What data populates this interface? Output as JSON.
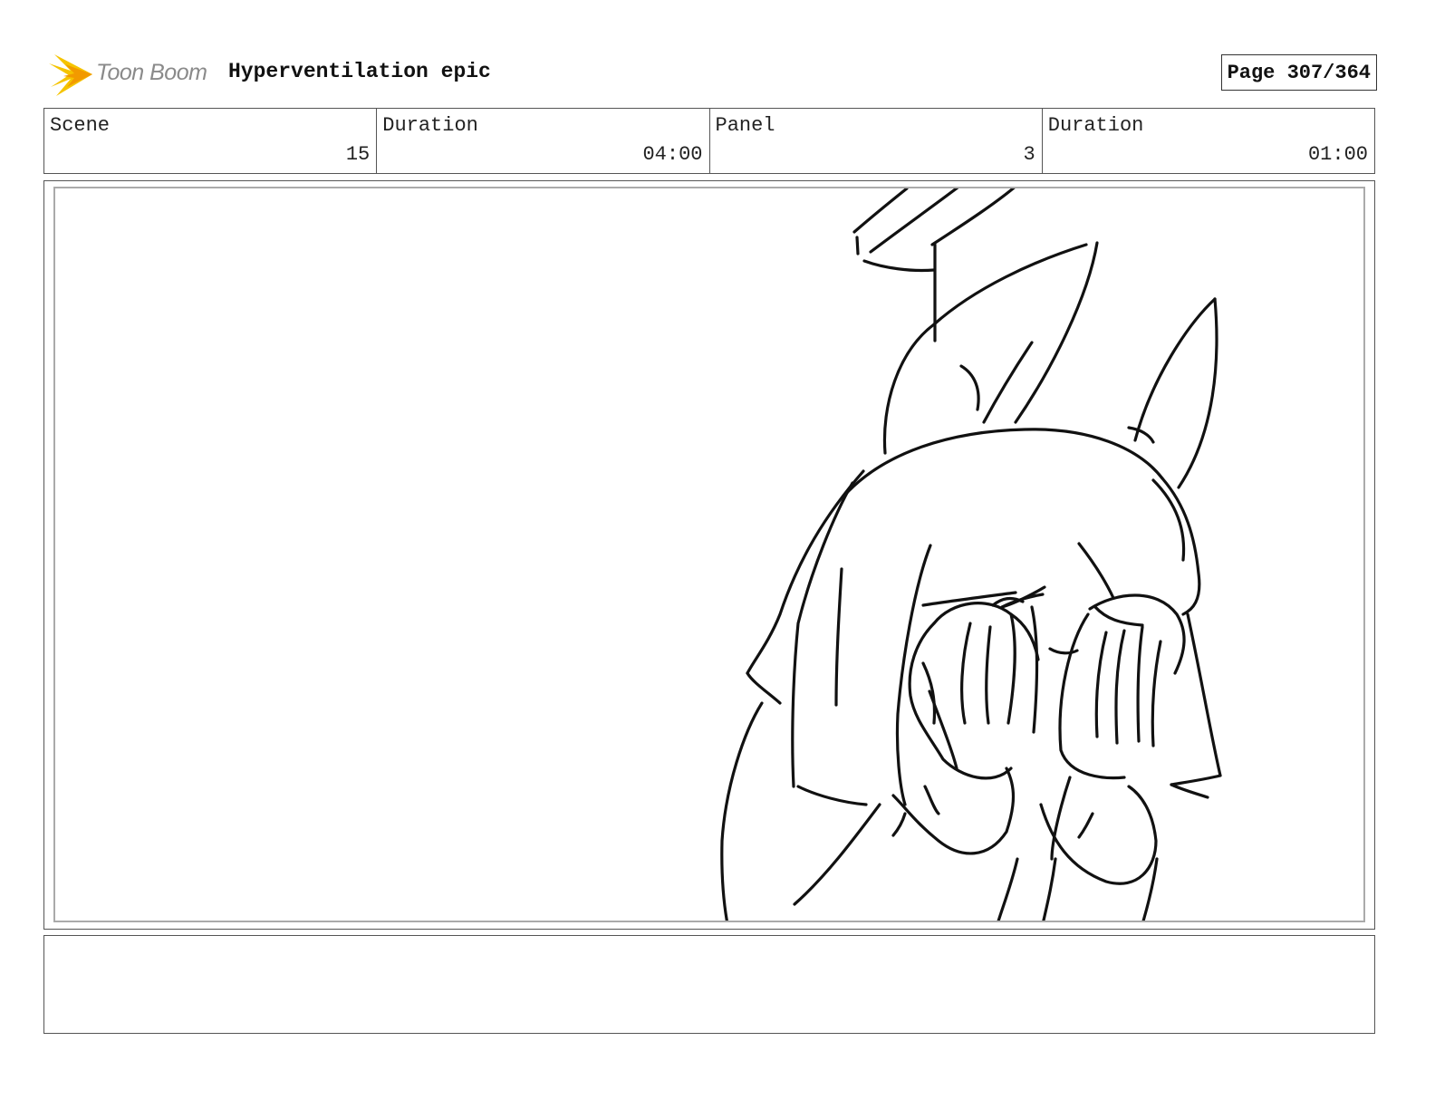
{
  "header": {
    "logo_text": "Toon Boom",
    "project_title": "Hyperventilation epic",
    "page_label": "Page 307/364"
  },
  "info": {
    "scene_label": "Scene",
    "scene_value": "15",
    "scene_duration_label": "Duration",
    "scene_duration_value": "04:00",
    "panel_label": "Panel",
    "panel_value": "3",
    "panel_duration_label": "Duration",
    "panel_duration_value": "01:00"
  },
  "notes": {
    "text": ""
  },
  "colors": {
    "logo_yellow": "#f5c400",
    "logo_orange": "#f29a00",
    "ink": "#111111"
  }
}
